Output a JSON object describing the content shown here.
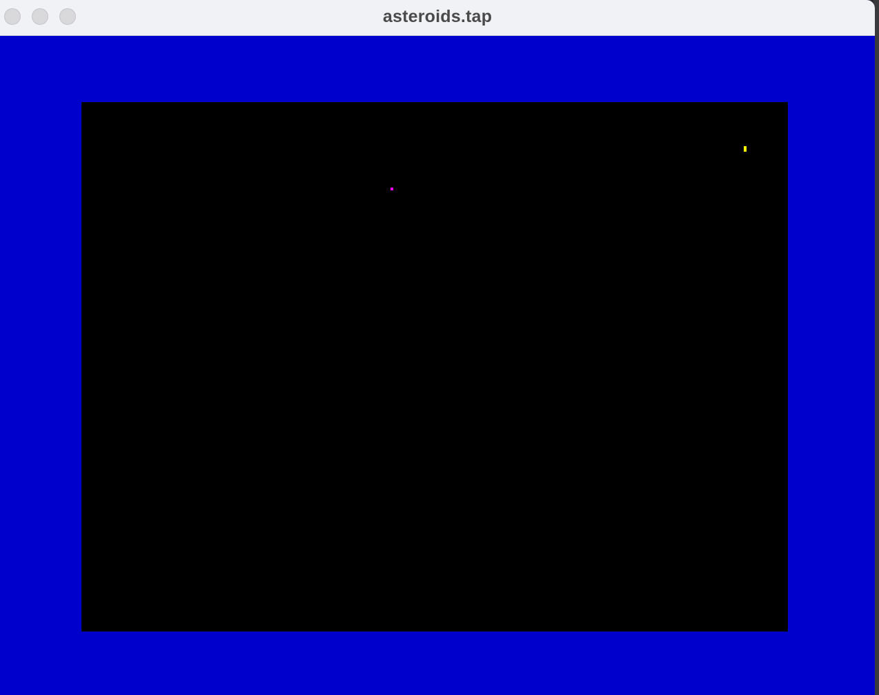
{
  "window": {
    "title": "asteroids.tap",
    "controls": {
      "close": "close",
      "minimize": "minimize",
      "zoom": "zoom"
    }
  },
  "emulator": {
    "border_color": "#0000cc",
    "paper_color": "#000000",
    "sprites": [
      {
        "name": "ship",
        "color": "#ffff00"
      },
      {
        "name": "asteroid",
        "color": "#ff00ff"
      }
    ]
  }
}
